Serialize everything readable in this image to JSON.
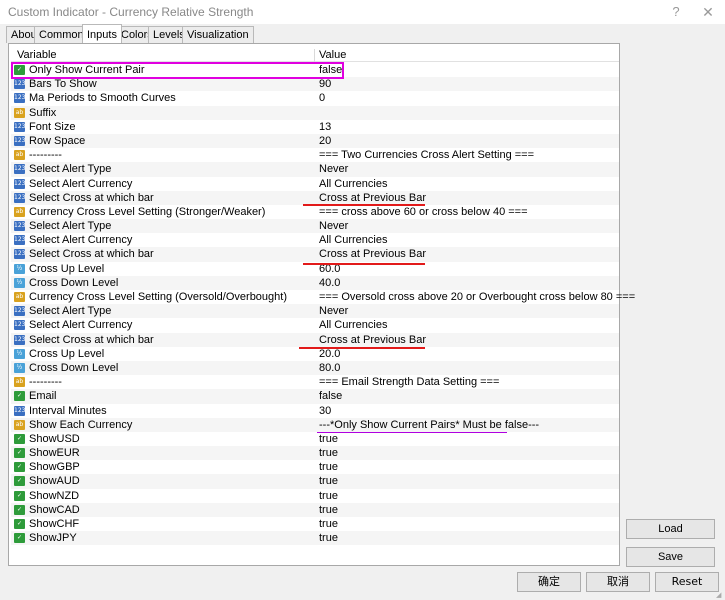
{
  "window": {
    "title": "Custom Indicator - Currency Relative Strength",
    "help_label": "?",
    "close_label": "✕"
  },
  "tabs": [
    {
      "label": "About"
    },
    {
      "label": "Common"
    },
    {
      "label": "Inputs",
      "active": true
    },
    {
      "label": "Colors"
    },
    {
      "label": "Levels"
    },
    {
      "label": "Visualization"
    }
  ],
  "grid": {
    "columns": {
      "variable": "Variable",
      "value": "Value"
    },
    "rows": [
      {
        "icon": "bool-icon",
        "name": "Only Show Current Pair",
        "value": "false"
      },
      {
        "icon": "int-icon",
        "name": "Bars To Show",
        "value": "90"
      },
      {
        "icon": "int-icon",
        "name": "Ma Periods to Smooth Curves",
        "value": "0"
      },
      {
        "icon": "string-icon",
        "name": "Suffix",
        "value": ""
      },
      {
        "icon": "int-icon",
        "name": "Font Size",
        "value": "13"
      },
      {
        "icon": "int-icon",
        "name": "Row Space",
        "value": "20"
      },
      {
        "icon": "string-icon",
        "name": "---------",
        "value": "=== Two Currencies Cross Alert Setting ==="
      },
      {
        "icon": "enum-icon",
        "name": "Select Alert Type",
        "value": "Never"
      },
      {
        "icon": "enum-icon",
        "name": "Select Alert Currency",
        "value": "All Currencies"
      },
      {
        "icon": "enum-icon",
        "name": "Select Cross at which bar",
        "value": "Cross at Previous Bar"
      },
      {
        "icon": "string-icon",
        "name": "Currency Cross Level Setting (Stronger/Weaker)",
        "value": "=== cross above 60 or cross below 40 ==="
      },
      {
        "icon": "enum-icon",
        "name": "Select Alert Type",
        "value": "Never"
      },
      {
        "icon": "enum-icon",
        "name": "Select Alert Currency",
        "value": "All Currencies"
      },
      {
        "icon": "enum-icon",
        "name": "Select Cross at which bar",
        "value": "Cross at Previous Bar"
      },
      {
        "icon": "double-icon",
        "name": "Cross Up Level",
        "value": "60.0"
      },
      {
        "icon": "double-icon",
        "name": "Cross Down Level",
        "value": "40.0"
      },
      {
        "icon": "string-icon",
        "name": "Currency Cross Level Setting (Oversold/Overbought)",
        "value": "=== Oversold cross above 20 or Overbought cross below 80 ==="
      },
      {
        "icon": "enum-icon",
        "name": "Select Alert Type",
        "value": "Never"
      },
      {
        "icon": "enum-icon",
        "name": "Select Alert Currency",
        "value": "All Currencies"
      },
      {
        "icon": "enum-icon",
        "name": "Select Cross at which bar",
        "value": "Cross at Previous Bar"
      },
      {
        "icon": "double-icon",
        "name": "Cross Up Level",
        "value": "20.0"
      },
      {
        "icon": "double-icon",
        "name": "Cross Down Level",
        "value": "80.0"
      },
      {
        "icon": "string-icon",
        "name": "---------",
        "value": "=== Email Strength Data Setting ==="
      },
      {
        "icon": "bool-icon",
        "name": "Email",
        "value": "false"
      },
      {
        "icon": "int-icon",
        "name": "Interval Minutes",
        "value": "30"
      },
      {
        "icon": "string-icon",
        "name": "Show Each Currency",
        "value": "---*Only Show Current Pairs* Must be false---"
      },
      {
        "icon": "bool-icon",
        "name": "ShowUSD",
        "value": "true"
      },
      {
        "icon": "bool-icon",
        "name": "ShowEUR",
        "value": "true"
      },
      {
        "icon": "bool-icon",
        "name": "ShowGBP",
        "value": "true"
      },
      {
        "icon": "bool-icon",
        "name": "ShowAUD",
        "value": "true"
      },
      {
        "icon": "bool-icon",
        "name": "ShowNZD",
        "value": "true"
      },
      {
        "icon": "bool-icon",
        "name": "ShowCAD",
        "value": "true"
      },
      {
        "icon": "bool-icon",
        "name": "ShowCHF",
        "value": "true"
      },
      {
        "icon": "bool-icon",
        "name": "ShowJPY",
        "value": "true"
      }
    ]
  },
  "side_buttons": {
    "load": "Load",
    "save": "Save"
  },
  "bottom_buttons": {
    "ok": "确定",
    "cancel": "取消",
    "reset": "Reset"
  },
  "colors": {
    "highlight_box": "#e000e0",
    "red_underline": "#e21a1a",
    "magenta_underline": "#b000e0"
  }
}
